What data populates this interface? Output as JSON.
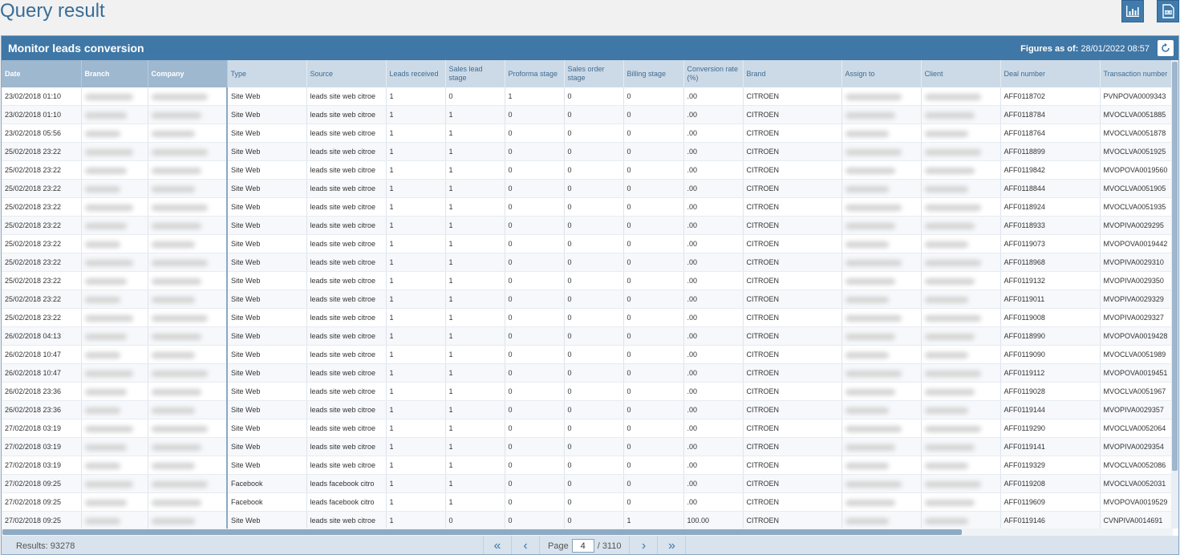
{
  "page": {
    "title": "Query result"
  },
  "toolbar": {
    "chart_icon": "bar-chart-icon",
    "export_icon": "excel-export-icon"
  },
  "panel": {
    "title": "Monitor leads conversion",
    "figures_label": "Figures as of:",
    "figures_value": "28/01/2022 08:57",
    "refresh_icon": "refresh-icon"
  },
  "columns": [
    "Date",
    "Branch",
    "Company",
    "Type",
    "Source",
    "Leads received",
    "Sales lead stage",
    "Proforma stage",
    "Sales order stage",
    "Billing stage",
    "Conversion rate (%)",
    "Brand",
    "Assign to",
    "Client",
    "Deal number",
    "Transaction number"
  ],
  "rows": [
    [
      "23/02/2018 01:10",
      "",
      "",
      "Site Web",
      "leads site web citroe",
      "1",
      "0",
      "1",
      "0",
      "0",
      ".00",
      "CITROEN",
      "",
      "",
      "AFF0118702",
      "PVNPOVA0009343"
    ],
    [
      "23/02/2018 01:10",
      "",
      "",
      "Site Web",
      "leads site web citroe",
      "1",
      "1",
      "0",
      "0",
      "0",
      ".00",
      "CITROEN",
      "",
      "",
      "AFF0118784",
      "MVOCLVA0051885"
    ],
    [
      "23/02/2018 05:56",
      "",
      "",
      "Site Web",
      "leads site web citroe",
      "1",
      "1",
      "0",
      "0",
      "0",
      ".00",
      "CITROEN",
      "",
      "",
      "AFF0118764",
      "MVOCLVA0051878"
    ],
    [
      "25/02/2018 23:22",
      "",
      "",
      "Site Web",
      "leads site web citroe",
      "1",
      "1",
      "0",
      "0",
      "0",
      ".00",
      "CITROEN",
      "",
      "",
      "AFF0118899",
      "MVOCLVA0051925"
    ],
    [
      "25/02/2018 23:22",
      "",
      "",
      "Site Web",
      "leads site web citroe",
      "1",
      "1",
      "0",
      "0",
      "0",
      ".00",
      "CITROEN",
      "",
      "",
      "AFF0119842",
      "MVOPOVA0019560"
    ],
    [
      "25/02/2018 23:22",
      "",
      "",
      "Site Web",
      "leads site web citroe",
      "1",
      "1",
      "0",
      "0",
      "0",
      ".00",
      "CITROEN",
      "",
      "",
      "AFF0118844",
      "MVOCLVA0051905"
    ],
    [
      "25/02/2018 23:22",
      "",
      "",
      "Site Web",
      "leads site web citroe",
      "1",
      "1",
      "0",
      "0",
      "0",
      ".00",
      "CITROEN",
      "",
      "",
      "AFF0118924",
      "MVOCLVA0051935"
    ],
    [
      "25/02/2018 23:22",
      "",
      "",
      "Site Web",
      "leads site web citroe",
      "1",
      "1",
      "0",
      "0",
      "0",
      ".00",
      "CITROEN",
      "",
      "",
      "AFF0118933",
      "MVOPIVA0029295"
    ],
    [
      "25/02/2018 23:22",
      "",
      "",
      "Site Web",
      "leads site web citroe",
      "1",
      "1",
      "0",
      "0",
      "0",
      ".00",
      "CITROEN",
      "",
      "",
      "AFF0119073",
      "MVOPOVA0019442"
    ],
    [
      "25/02/2018 23:22",
      "",
      "",
      "Site Web",
      "leads site web citroe",
      "1",
      "1",
      "0",
      "0",
      "0",
      ".00",
      "CITROEN",
      "",
      "",
      "AFF0118968",
      "MVOPIVA0029310"
    ],
    [
      "25/02/2018 23:22",
      "",
      "",
      "Site Web",
      "leads site web citroe",
      "1",
      "1",
      "0",
      "0",
      "0",
      ".00",
      "CITROEN",
      "",
      "",
      "AFF0119132",
      "MVOPIVA0029350"
    ],
    [
      "25/02/2018 23:22",
      "",
      "",
      "Site Web",
      "leads site web citroe",
      "1",
      "1",
      "0",
      "0",
      "0",
      ".00",
      "CITROEN",
      "",
      "",
      "AFF0119011",
      "MVOPIVA0029329"
    ],
    [
      "25/02/2018 23:22",
      "",
      "",
      "Site Web",
      "leads site web citroe",
      "1",
      "1",
      "0",
      "0",
      "0",
      ".00",
      "CITROEN",
      "",
      "",
      "AFF0119008",
      "MVOPIVA0029327"
    ],
    [
      "26/02/2018 04:13",
      "",
      "",
      "Site Web",
      "leads site web citroe",
      "1",
      "1",
      "0",
      "0",
      "0",
      ".00",
      "CITROEN",
      "",
      "",
      "AFF0118990",
      "MVOPOVA0019428"
    ],
    [
      "26/02/2018 10:47",
      "",
      "",
      "Site Web",
      "leads site web citroe",
      "1",
      "1",
      "0",
      "0",
      "0",
      ".00",
      "CITROEN",
      "",
      "",
      "AFF0119090",
      "MVOCLVA0051989"
    ],
    [
      "26/02/2018 10:47",
      "",
      "",
      "Site Web",
      "leads site web citroe",
      "1",
      "1",
      "0",
      "0",
      "0",
      ".00",
      "CITROEN",
      "",
      "",
      "AFF0119112",
      "MVOPOVA0019451"
    ],
    [
      "26/02/2018 23:36",
      "",
      "",
      "Site Web",
      "leads site web citroe",
      "1",
      "1",
      "0",
      "0",
      "0",
      ".00",
      "CITROEN",
      "",
      "",
      "AFF0119028",
      "MVOCLVA0051967"
    ],
    [
      "26/02/2018 23:36",
      "",
      "",
      "Site Web",
      "leads site web citroe",
      "1",
      "1",
      "0",
      "0",
      "0",
      ".00",
      "CITROEN",
      "",
      "",
      "AFF0119144",
      "MVOPIVA0029357"
    ],
    [
      "27/02/2018 03:19",
      "",
      "",
      "Site Web",
      "leads site web citroe",
      "1",
      "1",
      "0",
      "0",
      "0",
      ".00",
      "CITROEN",
      "",
      "",
      "AFF0119290",
      "MVOCLVA0052064"
    ],
    [
      "27/02/2018 03:19",
      "",
      "",
      "Site Web",
      "leads site web citroe",
      "1",
      "1",
      "0",
      "0",
      "0",
      ".00",
      "CITROEN",
      "",
      "",
      "AFF0119141",
      "MVOPIVA0029354"
    ],
    [
      "27/02/2018 03:19",
      "",
      "",
      "Site Web",
      "leads site web citroe",
      "1",
      "1",
      "0",
      "0",
      "0",
      ".00",
      "CITROEN",
      "",
      "",
      "AFF0119329",
      "MVOCLVA0052086"
    ],
    [
      "27/02/2018 09:25",
      "",
      "",
      "Facebook",
      "leads facebook citro",
      "1",
      "1",
      "0",
      "0",
      "0",
      ".00",
      "CITROEN",
      "",
      "",
      "AFF0119208",
      "MVOCLVA0052031"
    ],
    [
      "27/02/2018 09:25",
      "",
      "",
      "Facebook",
      "leads facebook citro",
      "1",
      "1",
      "0",
      "0",
      "0",
      ".00",
      "CITROEN",
      "",
      "",
      "AFF0119609",
      "MVOPOVA0019529"
    ],
    [
      "27/02/2018 09:25",
      "",
      "",
      "Site Web",
      "leads site web citroe",
      "1",
      "0",
      "0",
      "0",
      "1",
      "100.00",
      "CITROEN",
      "",
      "",
      "AFF0119146",
      "CVNPIVA0014691"
    ]
  ],
  "footer": {
    "results_label": "Results: 93278",
    "page_label": "Page",
    "page_value": "4",
    "page_total": "/ 3110",
    "first_icon": "double-chevron-left-icon",
    "prev_icon": "chevron-left-icon",
    "next_icon": "chevron-right-icon",
    "last_icon": "double-chevron-right-icon"
  }
}
